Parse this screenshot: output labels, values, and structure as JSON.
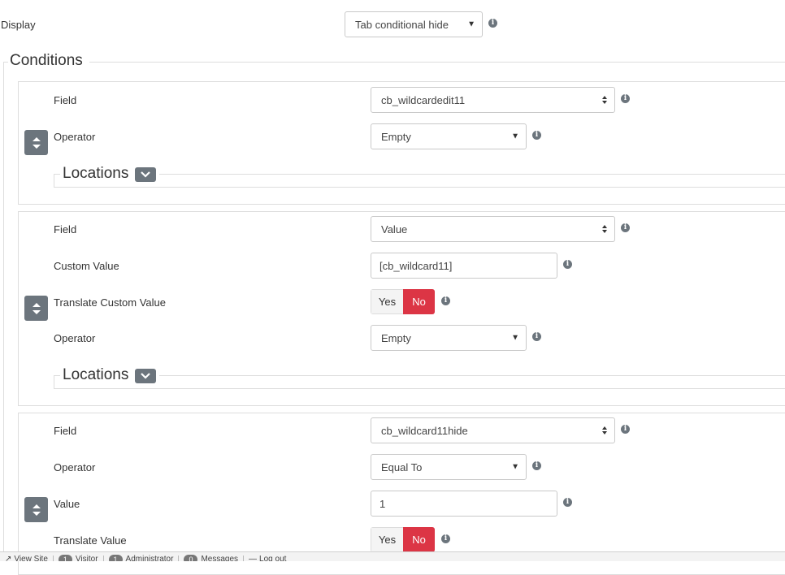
{
  "display": {
    "label": "Display",
    "value": "Tab conditional hide"
  },
  "conditions": {
    "legend": "Conditions"
  },
  "panels": [
    {
      "field": {
        "label": "Field",
        "value": "cb_wildcardedit11"
      },
      "operator": {
        "label": "Operator",
        "value": "Empty"
      },
      "locations": "Locations"
    },
    {
      "field": {
        "label": "Field",
        "value": "Value"
      },
      "custom_value": {
        "label": "Custom Value",
        "value": "[cb_wildcard11]"
      },
      "translate": {
        "label": "Translate Custom Value",
        "yes": "Yes",
        "no": "No"
      },
      "operator": {
        "label": "Operator",
        "value": "Empty"
      },
      "locations": "Locations"
    },
    {
      "field": {
        "label": "Field",
        "value": "cb_wildcard11hide"
      },
      "operator": {
        "label": "Operator",
        "value": "Equal To"
      },
      "value": {
        "label": "Value",
        "value": "1"
      },
      "translate": {
        "label": "Translate Value",
        "yes": "Yes",
        "no": "No"
      }
    }
  ],
  "footer": {
    "view_site": "View Site",
    "visitor_count": "1",
    "visitor_label": "Visitor",
    "admin_count": "1",
    "admin_label": "Administrator",
    "messages_count": "0",
    "messages_label": "Messages",
    "logout": "Log out"
  },
  "colors": {
    "accent_no": "#dc3545",
    "icon_gray": "#6c757d"
  }
}
